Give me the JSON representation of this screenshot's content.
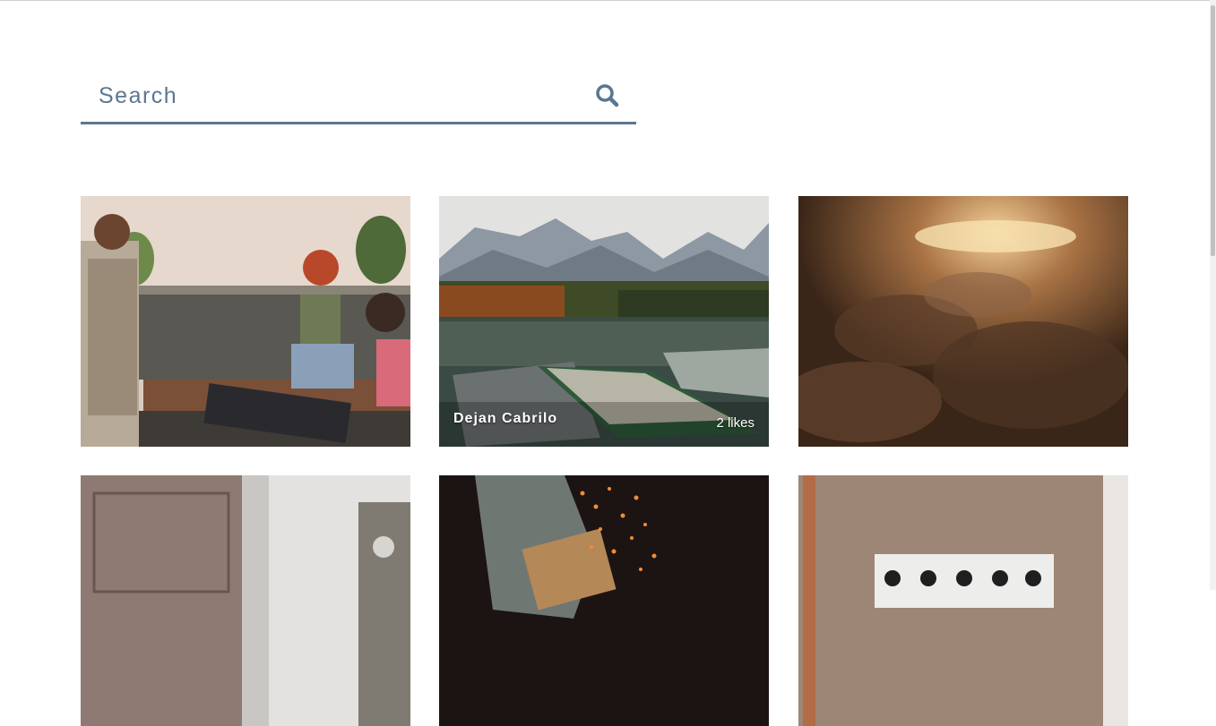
{
  "search": {
    "placeholder": "Search",
    "icon": "search-icon"
  },
  "photos": [
    {
      "author": "",
      "likes": ""
    },
    {
      "author": "Dejan Cabrilo",
      "likes": "2 likes"
    },
    {
      "author": "",
      "likes": ""
    },
    {
      "author": "",
      "likes": ""
    },
    {
      "author": "",
      "likes": ""
    },
    {
      "author": "",
      "likes": ""
    }
  ],
  "colors": {
    "accent": "#5b7690",
    "background": "#ffffff"
  }
}
